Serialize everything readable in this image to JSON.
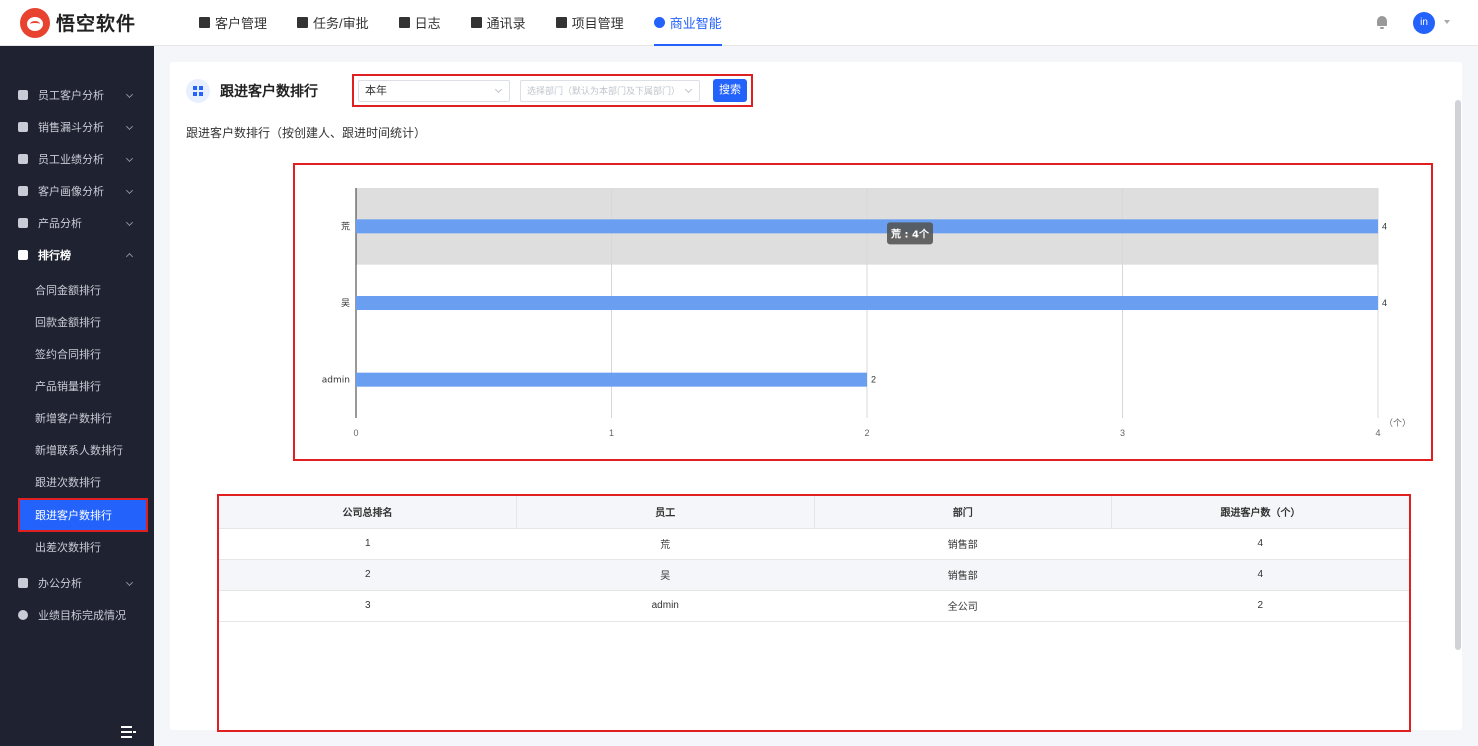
{
  "topbar": {
    "brand": "悟空软件",
    "nav": [
      {
        "label": "客户管理",
        "icon": "customer-icon",
        "active": false
      },
      {
        "label": "任务/审批",
        "icon": "briefcase-icon",
        "active": false
      },
      {
        "label": "日志",
        "icon": "log-icon",
        "active": false
      },
      {
        "label": "通讯录",
        "icon": "contacts-icon",
        "active": false
      },
      {
        "label": "项目管理",
        "icon": "project-icon",
        "active": false
      },
      {
        "label": "商业智能",
        "icon": "bi-icon",
        "active": true
      }
    ],
    "avatar_text": "in"
  },
  "sidebar": {
    "groups": [
      {
        "label": "员工客户分析",
        "icon": "person-icon"
      },
      {
        "label": "销售漏斗分析",
        "icon": "funnel-icon"
      },
      {
        "label": "员工业绩分析",
        "icon": "bar-chart-icon"
      },
      {
        "label": "客户画像分析",
        "icon": "people-icon"
      },
      {
        "label": "产品分析",
        "icon": "product-icon"
      },
      {
        "label": "排行榜",
        "icon": "trophy-icon"
      },
      {
        "label": "办公分析",
        "icon": "briefcase-icon"
      },
      {
        "label": "业绩目标完成情况",
        "icon": "target-icon"
      }
    ],
    "ranking_items": [
      "合同金额排行",
      "回款金额排行",
      "签约合同排行",
      "产品销量排行",
      "新增客户数排行",
      "新增联系人数排行",
      "跟进次数排行",
      "跟进客户数排行",
      "出差次数排行"
    ],
    "active_item": "跟进客户数排行"
  },
  "card": {
    "title": "跟进客户数排行",
    "filter_year": "本年",
    "filter_dept_placeholder": "选择部门（默认为本部门及下属部门）",
    "search_label": "搜索",
    "subtitle": "跟进客户数排行（按创建人、跟进时间统计）"
  },
  "chart_data": {
    "type": "bar",
    "orientation": "horizontal",
    "categories": [
      "荒",
      "吴",
      "admin"
    ],
    "values": [
      4,
      4,
      2
    ],
    "xlim": [
      0,
      4
    ],
    "xticks": [
      "0",
      "1",
      "2",
      "3",
      "4"
    ],
    "unit_label": "（个）",
    "tooltip": "荒 : 4个",
    "bar_color": "#6a9ef0",
    "highlight_band_color": "#dedede"
  },
  "table": {
    "headers": [
      "公司总排名",
      "员工",
      "部门",
      "跟进客户数（个）"
    ],
    "rows": [
      [
        "1",
        "荒",
        "销售部",
        "4"
      ],
      [
        "2",
        "吴",
        "销售部",
        "4"
      ],
      [
        "3",
        "admin",
        "全公司",
        "2"
      ]
    ]
  }
}
